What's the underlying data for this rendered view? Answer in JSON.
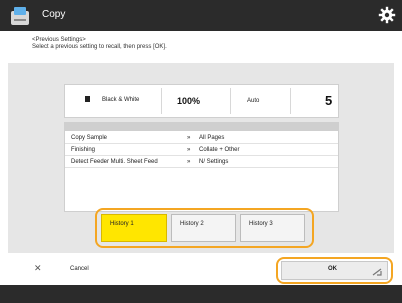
{
  "header": {
    "title": "Copy"
  },
  "instruction": {
    "line1": "<Previous Settings>",
    "line2": "Select a previous setting to recall, then press [OK]."
  },
  "summary": {
    "color_mode": "Black & White",
    "ratio": "100%",
    "paper": "Auto",
    "copies": "5"
  },
  "settings": [
    {
      "key": "Copy Sample",
      "sep": "»",
      "value": "All Pages"
    },
    {
      "key": "Finishing",
      "sep": "»",
      "value": "Collate + Other"
    },
    {
      "key": "Detect Feeder Multi. Sheet Feed",
      "sep": "»",
      "value": "N/ Settings"
    }
  ],
  "history": [
    {
      "label": "History 1",
      "selected": true
    },
    {
      "label": "History 2",
      "selected": false
    },
    {
      "label": "History 3",
      "selected": false
    }
  ],
  "buttons": {
    "cancel": "Cancel",
    "ok": "OK"
  },
  "colors": {
    "titlebar": "#2b2b2b",
    "highlight": "#f4a623",
    "selected": "#ffe600"
  },
  "icons": {
    "app": "copy-icon",
    "settings": "gear-icon",
    "cancel": "close-icon",
    "ok": "checkmark-icon"
  }
}
